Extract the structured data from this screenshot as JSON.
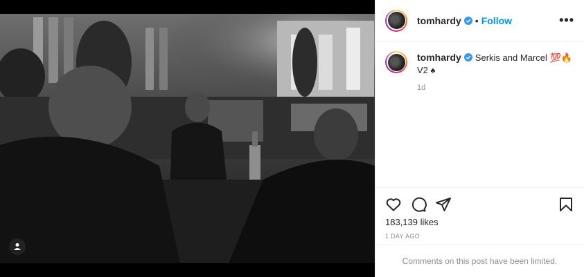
{
  "post": {
    "username": "tomhardy",
    "follow_label": "Follow",
    "separator": "•",
    "more_label": "•••",
    "caption_text": "Serkis and Marcel 💯🔥",
    "caption_line2": "V2 ♠",
    "caption_time": "1d",
    "likes": "183,139 likes",
    "time_ago": "1 DAY AGO",
    "comments_limited": "Comments on this post have been limited."
  },
  "icons": {
    "verified": "verified-badge-icon",
    "like": "heart-icon",
    "comment": "comment-icon",
    "share": "share-icon",
    "save": "bookmark-icon",
    "user_tag": "user-tag-icon"
  },
  "colors": {
    "follow": "#0095f6",
    "verified": "#3897f0",
    "muted": "#8e8e8e"
  }
}
